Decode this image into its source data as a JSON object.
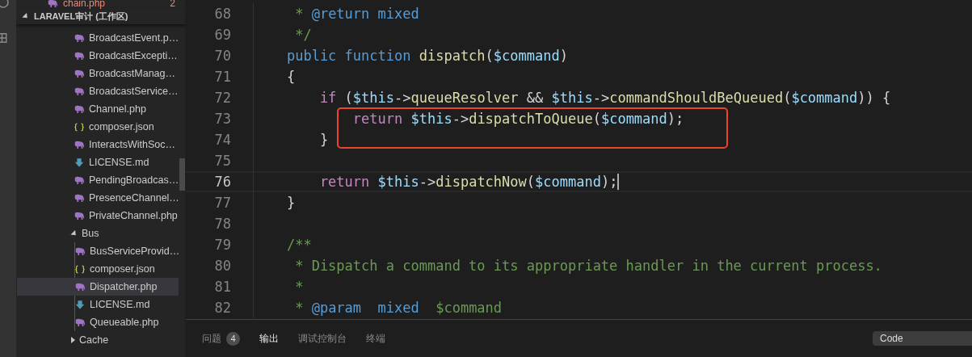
{
  "open_editors": [
    {
      "name": "chain.php",
      "badge": "2",
      "kind": "php"
    }
  ],
  "explorer": {
    "title": "LARAVEL审计 (工作区)",
    "expanded": true,
    "items": [
      {
        "name": "BroadcastEvent.p…",
        "kind": "php",
        "selected": false
      },
      {
        "name": "BroadcastExcepti…",
        "kind": "php",
        "selected": false
      },
      {
        "name": "BroadcastManag…",
        "kind": "php",
        "selected": false
      },
      {
        "name": "BroadcastService…",
        "kind": "php",
        "selected": false
      },
      {
        "name": "Channel.php",
        "kind": "php",
        "selected": false
      },
      {
        "name": "composer.json",
        "kind": "json",
        "selected": false
      },
      {
        "name": "InteractsWithSoc…",
        "kind": "php",
        "selected": false
      },
      {
        "name": "LICENSE.md",
        "kind": "md",
        "selected": false
      },
      {
        "name": "PendingBroadcas…",
        "kind": "php",
        "selected": false
      },
      {
        "name": "PresenceChannel…",
        "kind": "php",
        "selected": false
      },
      {
        "name": "PrivateChannel.php",
        "kind": "php",
        "selected": false
      },
      {
        "name": "Bus",
        "kind": "folder",
        "expanded": true,
        "selected": false,
        "children": [
          {
            "name": "BusServiceProvid…",
            "kind": "php",
            "selected": false
          },
          {
            "name": "composer.json",
            "kind": "json",
            "selected": false
          },
          {
            "name": "Dispatcher.php",
            "kind": "php",
            "selected": true
          },
          {
            "name": "LICENSE.md",
            "kind": "md",
            "selected": false
          },
          {
            "name": "Queueable.php",
            "kind": "php",
            "selected": false
          }
        ]
      },
      {
        "name": "Cache",
        "kind": "folder",
        "expanded": false,
        "selected": false
      }
    ]
  },
  "code": {
    "lines": [
      {
        "number": "68",
        "current": false,
        "tokens": [
          {
            "text": "     * ",
            "kind": "comment"
          },
          {
            "text": "@return mixed",
            "kind": "doctag"
          }
        ]
      },
      {
        "number": "69",
        "current": false,
        "tokens": [
          {
            "text": "     */",
            "kind": "comment"
          }
        ]
      },
      {
        "number": "70",
        "current": false,
        "tokens": [
          {
            "text": "    public function ",
            "kind": "keyword"
          },
          {
            "text": "dispatch",
            "kind": "func"
          },
          {
            "text": "(",
            "kind": "plain"
          },
          {
            "text": "$command",
            "kind": "var"
          },
          {
            "text": ")",
            "kind": "plain"
          }
        ]
      },
      {
        "number": "71",
        "current": false,
        "tokens": [
          {
            "text": "    {",
            "kind": "plain"
          }
        ]
      },
      {
        "number": "72",
        "current": false,
        "tokens": [
          {
            "text": "        if",
            "kind": "control"
          },
          {
            "text": " (",
            "kind": "plain"
          },
          {
            "text": "$this",
            "kind": "var"
          },
          {
            "text": "->",
            "kind": "plain"
          },
          {
            "text": "queueResolver",
            "kind": "func"
          },
          {
            "text": " && ",
            "kind": "plain"
          },
          {
            "text": "$this",
            "kind": "var"
          },
          {
            "text": "->",
            "kind": "plain"
          },
          {
            "text": "commandShouldBeQueued",
            "kind": "func"
          },
          {
            "text": "(",
            "kind": "plain"
          },
          {
            "text": "$command",
            "kind": "var"
          },
          {
            "text": ")) {",
            "kind": "plain"
          }
        ]
      },
      {
        "number": "73",
        "current": false,
        "tokens": [
          {
            "text": "            return ",
            "kind": "control"
          },
          {
            "text": "$this",
            "kind": "var"
          },
          {
            "text": "->",
            "kind": "plain"
          },
          {
            "text": "dispatchToQueue",
            "kind": "func"
          },
          {
            "text": "(",
            "kind": "plain"
          },
          {
            "text": "$command",
            "kind": "var"
          },
          {
            "text": ");",
            "kind": "plain"
          }
        ]
      },
      {
        "number": "74",
        "current": false,
        "tokens": [
          {
            "text": "        }",
            "kind": "plain"
          }
        ]
      },
      {
        "number": "75",
        "current": false
      },
      {
        "number": "76",
        "current": true,
        "tokens": [
          {
            "text": "        return ",
            "kind": "control"
          },
          {
            "text": "$this",
            "kind": "var"
          },
          {
            "text": "->",
            "kind": "plain"
          },
          {
            "text": "dispatchNow",
            "kind": "func"
          },
          {
            "text": "(",
            "kind": "plain"
          },
          {
            "text": "$command",
            "kind": "var"
          },
          {
            "text": ");",
            "kind": "plain"
          }
        ]
      },
      {
        "number": "77",
        "current": false,
        "tokens": [
          {
            "text": "    }",
            "kind": "plain"
          }
        ]
      },
      {
        "number": "78",
        "current": false
      },
      {
        "number": "79",
        "current": false,
        "tokens": [
          {
            "text": "    /**",
            "kind": "comment"
          }
        ]
      },
      {
        "number": "80",
        "current": false,
        "tokens": [
          {
            "text": "     * Dispatch a command to its appropriate handler in the current process.",
            "kind": "comment"
          }
        ]
      },
      {
        "number": "81",
        "current": false,
        "tokens": [
          {
            "text": "     *",
            "kind": "comment"
          }
        ]
      },
      {
        "number": "82",
        "current": false,
        "tokens": [
          {
            "text": "     * ",
            "kind": "comment"
          },
          {
            "text": "@param  mixed",
            "kind": "doctag"
          },
          {
            "text": "  $command",
            "kind": "comment"
          }
        ]
      }
    ]
  },
  "panel": {
    "tabs": [
      {
        "label": "问题",
        "badge": "4",
        "selected": false
      },
      {
        "label": "输出",
        "selected": true
      },
      {
        "label": "调试控制台",
        "selected": false
      },
      {
        "label": "终端",
        "selected": false
      }
    ],
    "channel_select": {
      "value": "Code"
    }
  }
}
